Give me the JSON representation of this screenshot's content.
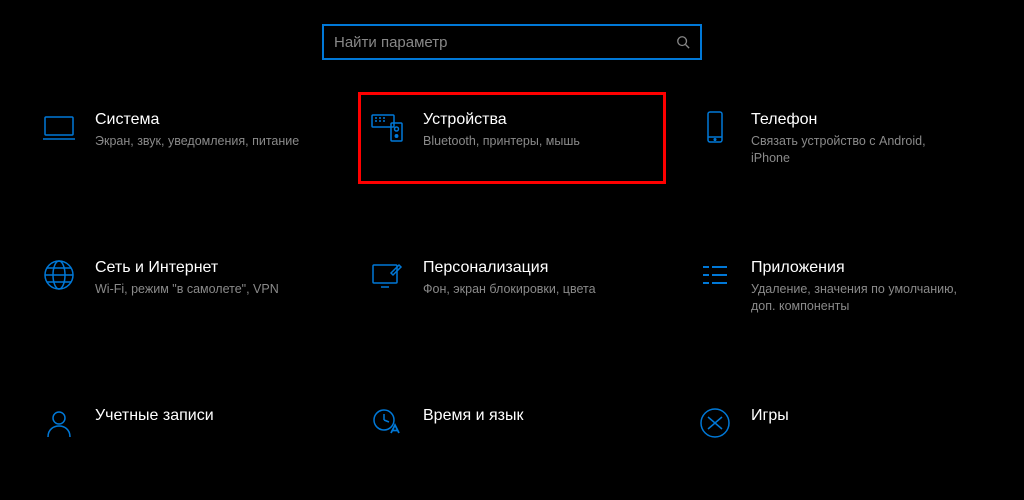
{
  "search": {
    "placeholder": "Найти параметр"
  },
  "tiles": {
    "system": {
      "title": "Система",
      "desc": "Экран, звук, уведомления, питание"
    },
    "devices": {
      "title": "Устройства",
      "desc": "Bluetooth, принтеры, мышь"
    },
    "phone": {
      "title": "Телефон",
      "desc": "Связать устройство с Android, iPhone"
    },
    "network": {
      "title": "Сеть и Интернет",
      "desc": "Wi-Fi, режим \"в самолете\", VPN"
    },
    "personalization": {
      "title": "Персонализация",
      "desc": "Фон, экран блокировки, цвета"
    },
    "apps": {
      "title": "Приложения",
      "desc": "Удаление, значения по умолчанию, доп. компоненты"
    },
    "accounts": {
      "title": "Учетные записи",
      "desc": ""
    },
    "time": {
      "title": "Время и язык",
      "desc": ""
    },
    "gaming": {
      "title": "Игры",
      "desc": ""
    }
  },
  "colors": {
    "accent": "#0078d7",
    "highlight": "#ff0000"
  }
}
